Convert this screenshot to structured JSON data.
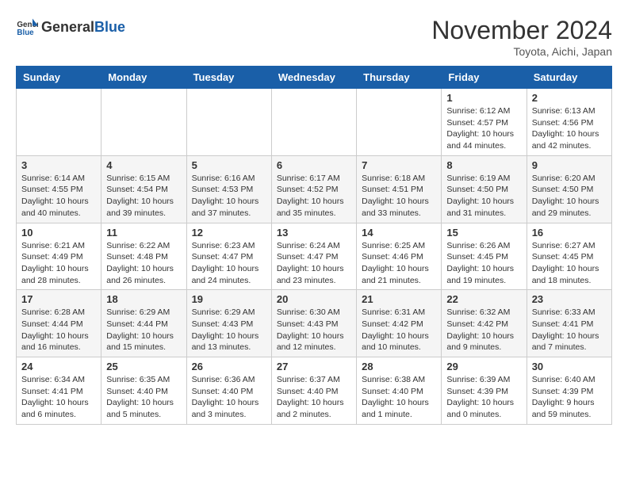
{
  "header": {
    "logo_general": "General",
    "logo_blue": "Blue",
    "title": "November 2024",
    "location": "Toyota, Aichi, Japan"
  },
  "weekdays": [
    "Sunday",
    "Monday",
    "Tuesday",
    "Wednesday",
    "Thursday",
    "Friday",
    "Saturday"
  ],
  "weeks": [
    [
      {
        "day": "",
        "info": ""
      },
      {
        "day": "",
        "info": ""
      },
      {
        "day": "",
        "info": ""
      },
      {
        "day": "",
        "info": ""
      },
      {
        "day": "",
        "info": ""
      },
      {
        "day": "1",
        "info": "Sunrise: 6:12 AM\nSunset: 4:57 PM\nDaylight: 10 hours\nand 44 minutes."
      },
      {
        "day": "2",
        "info": "Sunrise: 6:13 AM\nSunset: 4:56 PM\nDaylight: 10 hours\nand 42 minutes."
      }
    ],
    [
      {
        "day": "3",
        "info": "Sunrise: 6:14 AM\nSunset: 4:55 PM\nDaylight: 10 hours\nand 40 minutes."
      },
      {
        "day": "4",
        "info": "Sunrise: 6:15 AM\nSunset: 4:54 PM\nDaylight: 10 hours\nand 39 minutes."
      },
      {
        "day": "5",
        "info": "Sunrise: 6:16 AM\nSunset: 4:53 PM\nDaylight: 10 hours\nand 37 minutes."
      },
      {
        "day": "6",
        "info": "Sunrise: 6:17 AM\nSunset: 4:52 PM\nDaylight: 10 hours\nand 35 minutes."
      },
      {
        "day": "7",
        "info": "Sunrise: 6:18 AM\nSunset: 4:51 PM\nDaylight: 10 hours\nand 33 minutes."
      },
      {
        "day": "8",
        "info": "Sunrise: 6:19 AM\nSunset: 4:50 PM\nDaylight: 10 hours\nand 31 minutes."
      },
      {
        "day": "9",
        "info": "Sunrise: 6:20 AM\nSunset: 4:50 PM\nDaylight: 10 hours\nand 29 minutes."
      }
    ],
    [
      {
        "day": "10",
        "info": "Sunrise: 6:21 AM\nSunset: 4:49 PM\nDaylight: 10 hours\nand 28 minutes."
      },
      {
        "day": "11",
        "info": "Sunrise: 6:22 AM\nSunset: 4:48 PM\nDaylight: 10 hours\nand 26 minutes."
      },
      {
        "day": "12",
        "info": "Sunrise: 6:23 AM\nSunset: 4:47 PM\nDaylight: 10 hours\nand 24 minutes."
      },
      {
        "day": "13",
        "info": "Sunrise: 6:24 AM\nSunset: 4:47 PM\nDaylight: 10 hours\nand 23 minutes."
      },
      {
        "day": "14",
        "info": "Sunrise: 6:25 AM\nSunset: 4:46 PM\nDaylight: 10 hours\nand 21 minutes."
      },
      {
        "day": "15",
        "info": "Sunrise: 6:26 AM\nSunset: 4:45 PM\nDaylight: 10 hours\nand 19 minutes."
      },
      {
        "day": "16",
        "info": "Sunrise: 6:27 AM\nSunset: 4:45 PM\nDaylight: 10 hours\nand 18 minutes."
      }
    ],
    [
      {
        "day": "17",
        "info": "Sunrise: 6:28 AM\nSunset: 4:44 PM\nDaylight: 10 hours\nand 16 minutes."
      },
      {
        "day": "18",
        "info": "Sunrise: 6:29 AM\nSunset: 4:44 PM\nDaylight: 10 hours\nand 15 minutes."
      },
      {
        "day": "19",
        "info": "Sunrise: 6:29 AM\nSunset: 4:43 PM\nDaylight: 10 hours\nand 13 minutes."
      },
      {
        "day": "20",
        "info": "Sunrise: 6:30 AM\nSunset: 4:43 PM\nDaylight: 10 hours\nand 12 minutes."
      },
      {
        "day": "21",
        "info": "Sunrise: 6:31 AM\nSunset: 4:42 PM\nDaylight: 10 hours\nand 10 minutes."
      },
      {
        "day": "22",
        "info": "Sunrise: 6:32 AM\nSunset: 4:42 PM\nDaylight: 10 hours\nand 9 minutes."
      },
      {
        "day": "23",
        "info": "Sunrise: 6:33 AM\nSunset: 4:41 PM\nDaylight: 10 hours\nand 7 minutes."
      }
    ],
    [
      {
        "day": "24",
        "info": "Sunrise: 6:34 AM\nSunset: 4:41 PM\nDaylight: 10 hours\nand 6 minutes."
      },
      {
        "day": "25",
        "info": "Sunrise: 6:35 AM\nSunset: 4:40 PM\nDaylight: 10 hours\nand 5 minutes."
      },
      {
        "day": "26",
        "info": "Sunrise: 6:36 AM\nSunset: 4:40 PM\nDaylight: 10 hours\nand 3 minutes."
      },
      {
        "day": "27",
        "info": "Sunrise: 6:37 AM\nSunset: 4:40 PM\nDaylight: 10 hours\nand 2 minutes."
      },
      {
        "day": "28",
        "info": "Sunrise: 6:38 AM\nSunset: 4:40 PM\nDaylight: 10 hours\nand 1 minute."
      },
      {
        "day": "29",
        "info": "Sunrise: 6:39 AM\nSunset: 4:39 PM\nDaylight: 10 hours\nand 0 minutes."
      },
      {
        "day": "30",
        "info": "Sunrise: 6:40 AM\nSunset: 4:39 PM\nDaylight: 9 hours\nand 59 minutes."
      }
    ]
  ]
}
